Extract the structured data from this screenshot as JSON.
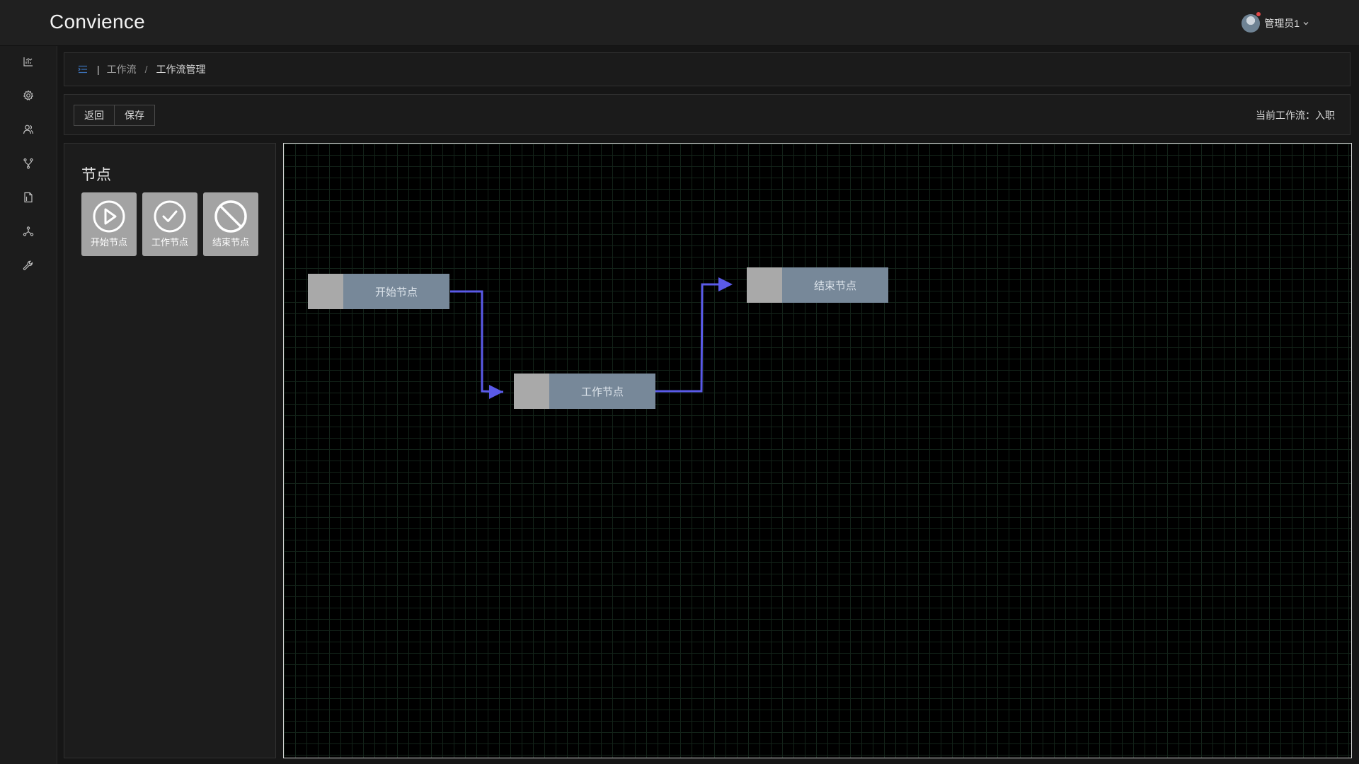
{
  "app": {
    "title": "Convience"
  },
  "user": {
    "name": "管理员1"
  },
  "sidebar": {
    "items": [
      {
        "icon": "chart-icon"
      },
      {
        "icon": "gear-icon"
      },
      {
        "icon": "users-icon"
      },
      {
        "icon": "workflow-branch-icon"
      },
      {
        "icon": "document-icon"
      },
      {
        "icon": "cluster-icon"
      },
      {
        "icon": "wrench-icon"
      }
    ]
  },
  "breadcrumb": {
    "separator_bar": "|",
    "items": [
      "工作流",
      "工作流管理"
    ],
    "separator": "/"
  },
  "toolbar": {
    "back_label": "返回",
    "save_label": "保存",
    "current_workflow_label": "当前工作流：入职"
  },
  "palette": {
    "title": "节点",
    "items": [
      {
        "label": "开始节点",
        "icon": "play-circle-icon"
      },
      {
        "label": "工作节点",
        "icon": "check-circle-icon"
      },
      {
        "label": "结束节点",
        "icon": "stop-circle-icon"
      }
    ]
  },
  "canvas": {
    "nodes": [
      {
        "id": "start",
        "label": "开始节点"
      },
      {
        "id": "work",
        "label": "工作节点"
      },
      {
        "id": "end",
        "label": "结束节点"
      }
    ],
    "connections": [
      {
        "from": "start",
        "to": "work"
      },
      {
        "from": "work",
        "to": "end"
      }
    ]
  },
  "colors": {
    "node_body": "#778899",
    "node_handle": "#a9a9a9",
    "connector": "#5a5ae8",
    "palette_item": "#a3a3a3",
    "canvas_bg": "#000000",
    "grid_line": "#132319"
  }
}
